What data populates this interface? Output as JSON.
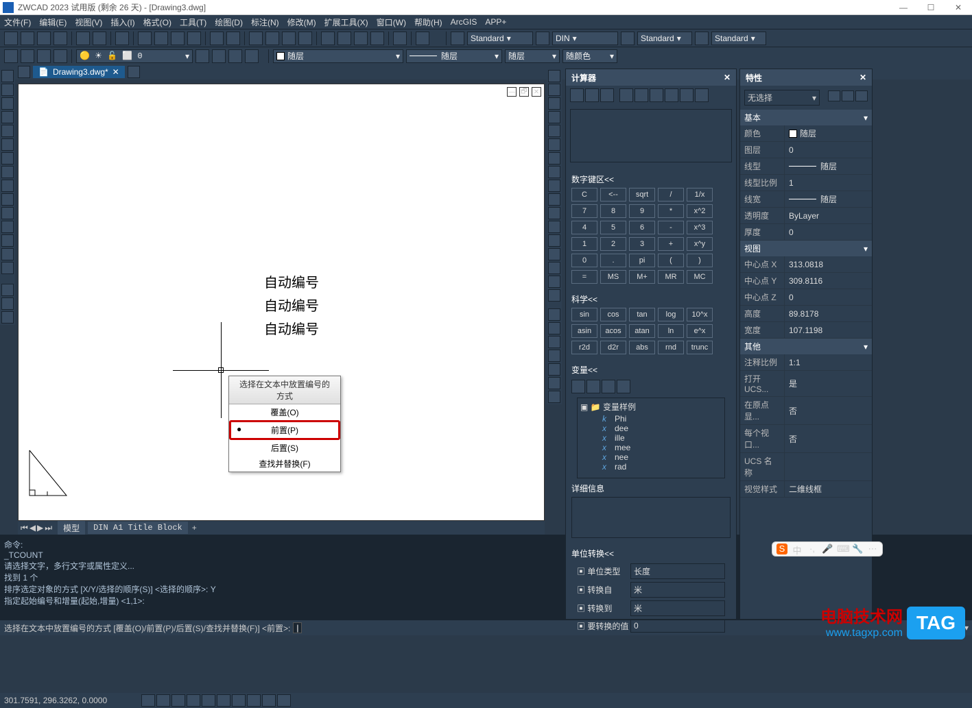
{
  "titlebar": {
    "text": "ZWCAD 2023 试用版 (剩余 26 天) - [Drawing3.dwg]"
  },
  "menu": [
    "文件(F)",
    "编辑(E)",
    "视图(V)",
    "插入(I)",
    "格式(O)",
    "工具(T)",
    "绘图(D)",
    "标注(N)",
    "修改(M)",
    "扩展工具(X)",
    "窗口(W)",
    "帮助(H)",
    "ArcGIS",
    "APP+"
  ],
  "style_dropdowns": {
    "text_style": "Standard",
    "dim_style": "DIN",
    "table_style": "Standard",
    "mleader_style": "Standard"
  },
  "layer_dropdowns": {
    "layer": "随层",
    "linetype": "随层",
    "lineweight": "随层",
    "color": "随颜色"
  },
  "doc_tab": "Drawing3.dwg*",
  "canvas_labels": [
    "自动编号",
    "自动编号",
    "自动编号"
  ],
  "context_menu": {
    "title": "选择在文本中放置编号的方式",
    "items": [
      "覆盖(O)",
      "前置(P)",
      "后置(S)",
      "查找并替换(F)"
    ]
  },
  "bottom_tabs": {
    "model": "模型",
    "layout": "DIN A1 Title Block"
  },
  "command_history": [
    "命令:",
    "_TCOUNT",
    "请选择文字，多行文字或属性定义...",
    "找到 1 个",
    "排序选定对象的方式 [X/Y/选择的顺序(S)] <选择的顺序>: Y",
    "指定起始编号和增量(起始,增量) <1,1>:"
  ],
  "command_prompt": "选择在文本中放置编号的方式 [覆盖(O)/前置(P)/后置(S)/查找并替换(F)] <前置>:",
  "status_coords": "301.7591, 296.3262, 0.0000",
  "calc": {
    "title": "计算器",
    "numpad_label": "数字键区<<",
    "numpad": [
      "C",
      "<--",
      "sqrt",
      "/",
      "1/x",
      "7",
      "8",
      "9",
      "*",
      "x^2",
      "4",
      "5",
      "6",
      "-",
      "x^3",
      "1",
      "2",
      "3",
      "+",
      "x^y",
      "0",
      ".",
      "pi",
      "(",
      "=",
      "MS",
      "M+",
      "MR",
      "MC"
    ],
    "numpad_row5_extra": ")",
    "sci_label": "科学<<",
    "sci": [
      "sin",
      "cos",
      "tan",
      "log",
      "10^x",
      "asin",
      "acos",
      "atan",
      "ln",
      "e^x",
      "r2d",
      "d2r",
      "abs",
      "rnd",
      "trunc"
    ],
    "var_label": "变量<<",
    "var_folder": "变量样例",
    "vars": [
      "Phi",
      "dee",
      "ille",
      "mee",
      "nee",
      "rad"
    ],
    "detail_label": "详细信息",
    "unit_label": "单位转换<<",
    "unit_rows": [
      {
        "label": "单位类型",
        "value": "长度"
      },
      {
        "label": "转换自",
        "value": "米"
      },
      {
        "label": "转换到",
        "value": "米"
      },
      {
        "label": "要转换的值",
        "value": "0"
      }
    ]
  },
  "props": {
    "title": "特性",
    "selection": "无选择",
    "groups": [
      {
        "name": "基本",
        "rows": [
          {
            "k": "颜色",
            "v": "随层",
            "type": "color"
          },
          {
            "k": "图层",
            "v": "0"
          },
          {
            "k": "线型",
            "v": "随层",
            "type": "line"
          },
          {
            "k": "线型比例",
            "v": "1"
          },
          {
            "k": "线宽",
            "v": "随层",
            "type": "line"
          },
          {
            "k": "透明度",
            "v": "ByLayer"
          },
          {
            "k": "厚度",
            "v": "0"
          }
        ]
      },
      {
        "name": "视图",
        "rows": [
          {
            "k": "中心点 X",
            "v": "313.0818"
          },
          {
            "k": "中心点 Y",
            "v": "309.8116"
          },
          {
            "k": "中心点 Z",
            "v": "0"
          },
          {
            "k": "高度",
            "v": "89.8178"
          },
          {
            "k": "宽度",
            "v": "107.1198"
          }
        ]
      },
      {
        "name": "其他",
        "rows": [
          {
            "k": "注释比例",
            "v": "1:1"
          },
          {
            "k": "打开 UCS...",
            "v": "是"
          },
          {
            "k": "在原点显...",
            "v": "否"
          },
          {
            "k": "每个视口...",
            "v": "否"
          },
          {
            "k": "UCS 名称",
            "v": ""
          },
          {
            "k": "视觉样式",
            "v": "二维线框"
          }
        ]
      }
    ]
  },
  "ime": [
    "中",
    "·,",
    "🎤",
    "⌨",
    "🔧",
    "⋯"
  ],
  "wm": {
    "text": "电脑技术网",
    "tag": "TAG",
    "url": "www.tagxp.com"
  }
}
